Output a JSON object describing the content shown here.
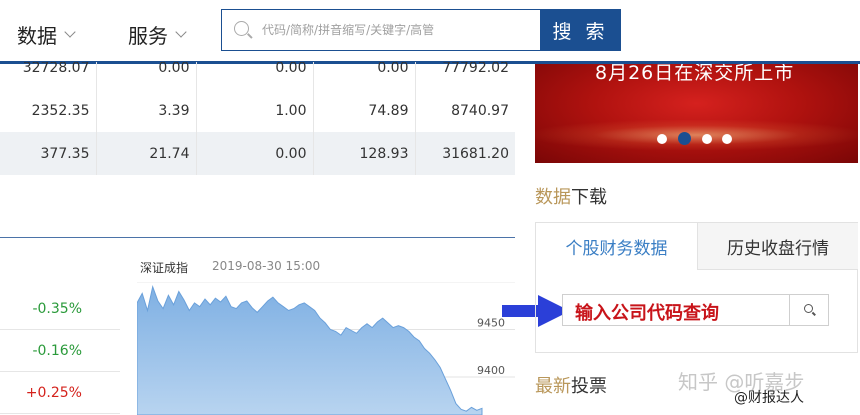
{
  "nav": {
    "items": [
      {
        "label": "数据"
      },
      {
        "label": "服务"
      }
    ],
    "search": {
      "placeholder": "代码/简称/拼音缩写/关键字/高管",
      "button_label": "搜 索"
    }
  },
  "table": {
    "rows": [
      [
        "32728.07",
        "0.00",
        "0.00",
        "0.00",
        "77792.02"
      ],
      [
        "2352.35",
        "3.39",
        "1.00",
        "74.89",
        "8740.97"
      ],
      [
        "377.35",
        "21.74",
        "0.00",
        "128.93",
        "31681.20"
      ]
    ]
  },
  "index_changes": [
    "-0.35%",
    "-0.16%",
    "+0.25%"
  ],
  "chart": {
    "title": "深证成指",
    "timestamp": "2019-08-30 15:00"
  },
  "chart_data": {
    "type": "area",
    "title": "深证成指",
    "ytick_labels": [
      "9450",
      "9400"
    ],
    "ylim": [
      9360,
      9500
    ],
    "values": [
      9478,
      9488,
      9470,
      9495,
      9480,
      9472,
      9486,
      9476,
      9490,
      9481,
      9470,
      9478,
      9474,
      9482,
      9476,
      9483,
      9479,
      9485,
      9474,
      9472,
      9478,
      9480,
      9473,
      9468,
      9474,
      9480,
      9484,
      9478,
      9474,
      9470,
      9472,
      9476,
      9478,
      9474,
      9470,
      9462,
      9457,
      9450,
      9448,
      9444,
      9452,
      9449,
      9446,
      9452,
      9456,
      9452,
      9458,
      9462,
      9457,
      9452,
      9454,
      9452,
      9448,
      9442,
      9438,
      9430,
      9425,
      9418,
      9410,
      9398,
      9386,
      9372,
      9366,
      9364,
      9368,
      9365,
      9367
    ]
  },
  "banner": {
    "text": "8月26日在深交所上市",
    "slide_count": 4,
    "active_slide": 2
  },
  "download": {
    "title_accent": "数据",
    "title_rest": "下载",
    "tabs": [
      "个股财务数据",
      "历史收盘行情"
    ],
    "input_hint": "输入公司代码查询"
  },
  "vote": {
    "title_accent": "最新",
    "title_rest": "投票"
  },
  "watermark": {
    "main": "知乎 @听嘉步",
    "sub": "@财报达人"
  },
  "colors": {
    "brand_blue": "#1b4f91",
    "accent_gold": "#b9975a",
    "down_green": "#2a9a3a",
    "up_red": "#d4221c",
    "arrow_blue": "#2b3fd8"
  }
}
